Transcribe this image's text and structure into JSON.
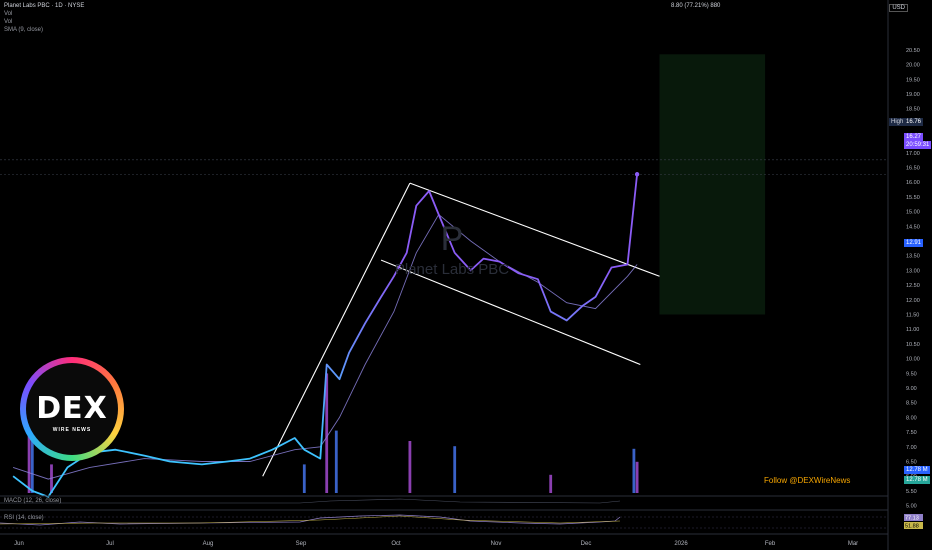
{
  "header": {
    "symbol_line": "Planet Labs PBC · 1D · NYSE",
    "legend": [
      "Vol",
      "Vol",
      "SMA (9, close)"
    ],
    "measure_label": "8.80 (77.21%) 880",
    "currency": "USD"
  },
  "watermark": {
    "ticker": "P",
    "name": "Planet Labs PBC"
  },
  "price_badges": {
    "high_label": "High",
    "high": "16.76",
    "last": "16.27",
    "last_time": "20:59:31",
    "prev": "12.91"
  },
  "volume_badges": [
    "12.78 M",
    "12.78 M"
  ],
  "indicators": {
    "macd_label": "MACD (12, 26, close)",
    "rsi_label": "RSI (14, close)",
    "rsi_values": [
      "77.13",
      "51.88"
    ]
  },
  "logo": {
    "text": "DEX",
    "subtitle": "WIRE NEWS"
  },
  "follow_text": "Follow @DEXWireNews",
  "colors": {
    "price_upper": "#8b5cf6",
    "price_lower": "#3dc3ff",
    "sma": "#8a80d8",
    "vol_up": "#3a62c8",
    "vol_down": "#8a3fb0",
    "channel": "#ffffff",
    "rsi": "#8f7fc8"
  },
  "chart_data": {
    "type": "line",
    "title": "Planet Labs PBC · 1D · NYSE",
    "xlabel": "",
    "ylabel": "",
    "x_ticks": [
      "Jun",
      "Jul",
      "Aug",
      "Sep",
      "Oct",
      "Nov",
      "Dec",
      "2026",
      "Feb",
      "Mar"
    ],
    "y_ticks": [
      "5.00",
      "5.50",
      "6.00",
      "6.50",
      "7.00",
      "7.50",
      "8.00",
      "8.50",
      "9.00",
      "9.50",
      "10.00",
      "10.50",
      "11.00",
      "11.50",
      "12.00",
      "12.50",
      "13.00",
      "13.50",
      "14.00",
      "14.50",
      "15.00",
      "15.50",
      "16.00",
      "16.50",
      "17.00",
      "17.50",
      "18.00",
      "18.50",
      "19.00",
      "19.50",
      "20.00",
      "20.50"
    ],
    "ylim": [
      4.9,
      20.8
    ],
    "grid": false,
    "price_series": {
      "name": "",
      "x": [
        "2025-05-30",
        "2025-06-05",
        "2025-06-10",
        "2025-06-16",
        "2025-06-23",
        "2025-07-01",
        "2025-07-10",
        "2025-07-18",
        "2025-07-28",
        "2025-08-05",
        "2025-08-12",
        "2025-08-19",
        "2025-08-26",
        "2025-08-29",
        "2025-09-03",
        "2025-09-05",
        "2025-09-09",
        "2025-09-12",
        "2025-09-17",
        "2025-09-22",
        "2025-09-26",
        "2025-09-30",
        "2025-10-03",
        "2025-10-07",
        "2025-10-10",
        "2025-10-15",
        "2025-10-20",
        "2025-10-24",
        "2025-10-29",
        "2025-11-04",
        "2025-11-10",
        "2025-11-14",
        "2025-11-19",
        "2025-11-24",
        "2025-11-28",
        "2025-12-03",
        "2025-12-08",
        "2025-12-11"
      ],
      "y": [
        6.0,
        5.5,
        5.3,
        6.3,
        6.8,
        6.9,
        6.7,
        6.5,
        6.4,
        6.5,
        6.6,
        6.9,
        7.3,
        6.9,
        6.6,
        9.8,
        9.3,
        10.2,
        11.2,
        12.1,
        12.8,
        13.6,
        15.2,
        15.7,
        14.9,
        13.6,
        13.0,
        13.4,
        13.3,
        12.9,
        12.7,
        11.6,
        11.3,
        11.8,
        12.1,
        13.1,
        13.2,
        16.27
      ]
    },
    "sma_series": {
      "name": "",
      "x": [
        "2025-05-30",
        "2025-06-10",
        "2025-06-23",
        "2025-07-10",
        "2025-07-28",
        "2025-08-12",
        "2025-08-26",
        "2025-09-03",
        "2025-09-09",
        "2025-09-17",
        "2025-09-26",
        "2025-10-03",
        "2025-10-10",
        "2025-10-20",
        "2025-10-29",
        "2025-11-10",
        "2025-11-19",
        "2025-11-28",
        "2025-12-08",
        "2025-12-11"
      ],
      "y": [
        6.3,
        5.9,
        6.3,
        6.6,
        6.5,
        6.5,
        6.9,
        7.0,
        8.0,
        9.8,
        11.6,
        13.6,
        14.9,
        14.0,
        13.3,
        12.6,
        11.9,
        11.7,
        12.8,
        13.2
      ]
    },
    "volume_series": {
      "name": "",
      "x": [
        "2025-06-04",
        "2025-06-05",
        "2025-06-11",
        "2025-08-29",
        "2025-09-05",
        "2025-09-08",
        "2025-10-01",
        "2025-10-15",
        "2025-11-14",
        "2025-12-10",
        "2025-12-11"
      ],
      "y": [
        68,
        57,
        22,
        22,
        92,
        48,
        40,
        36,
        14,
        34,
        24
      ]
    },
    "channel": {
      "upper": {
        "x": [
          "2025-10-01",
          "2025-12-18"
        ],
        "y": [
          15.97,
          12.8
        ]
      },
      "lower": {
        "x": [
          "2025-09-22",
          "2025-12-12"
        ],
        "y": [
          13.35,
          9.8
        ]
      },
      "left_rail": {
        "x": [
          "2025-08-16",
          "2025-10-01"
        ],
        "y": [
          6.0,
          15.97
        ]
      }
    },
    "projection_box": {
      "x": [
        "2025-12-18",
        "2026-01-20"
      ],
      "y": [
        11.5,
        20.35
      ]
    }
  }
}
